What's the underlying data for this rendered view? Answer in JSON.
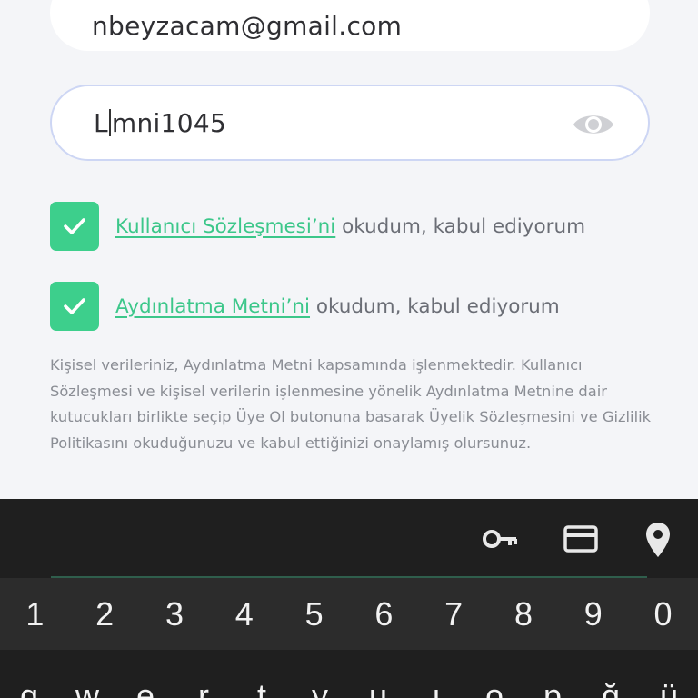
{
  "form": {
    "email_value": "nbeyzacam@gmail.com",
    "password_before_caret": "L",
    "password_after_caret": "mni1045"
  },
  "checkboxes": [
    {
      "link": "Kullanıcı Sözleşmesi’ni",
      "text": " okudum, kabul ediyorum",
      "checked": true
    },
    {
      "link": "Aydınlatma Metni’ni",
      "text": " okudum, kabul ediyorum",
      "checked": true
    }
  ],
  "info_text": "Kişisel verileriniz, Aydınlatma Metni kapsamında işlenmektedir. Kullanıcı Sözleşmesi ve kişisel verilerin işlenmesine yönelik Aydınlatma Metnine dair kutucukları birlikte seçip Üye Ol butonuna basarak Üyelik Sözleşmesini ve Gizlilik Politikasını okuduğunuzu ve kabul ettiğinizi onaylamış olursunuz.",
  "keyboard": {
    "numbers": [
      "1",
      "2",
      "3",
      "4",
      "5",
      "6",
      "7",
      "8",
      "9",
      "0"
    ],
    "letters": [
      "q",
      "w",
      "e",
      "r",
      "t",
      "y",
      "u",
      "ı",
      "o",
      "p",
      "ğ",
      "ü"
    ],
    "icons": [
      "key-icon",
      "card-icon",
      "location-pin-icon"
    ]
  },
  "colors": {
    "accent": "#3dcf8c",
    "keyboard_bg": "#1f1f1f",
    "number_row_bg": "#2c2c2c"
  }
}
